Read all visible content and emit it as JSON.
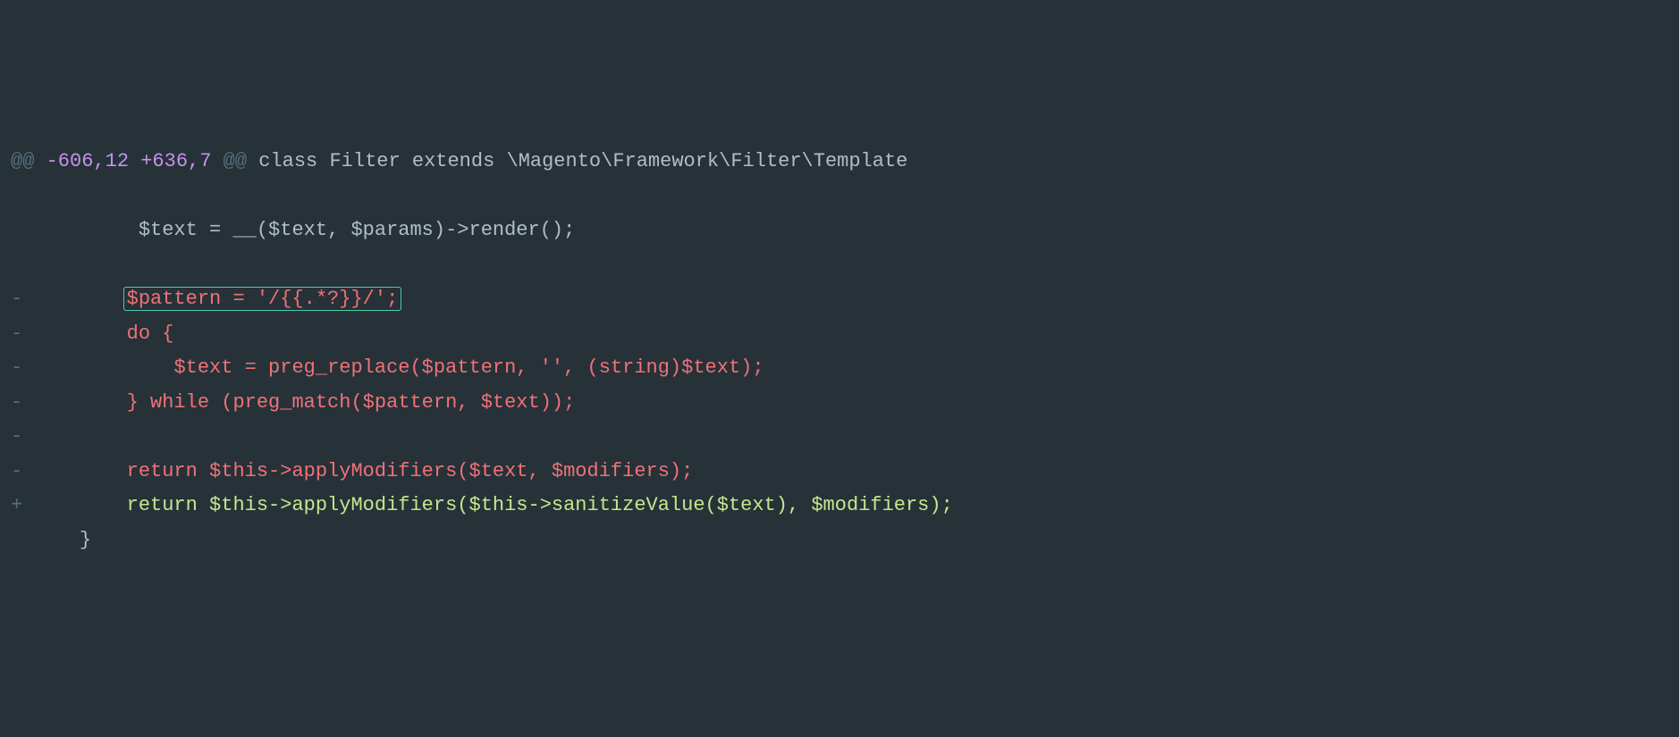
{
  "diff": {
    "hunk": {
      "marker_open": "@@",
      "range": " -606,12 +636,7 ",
      "marker_close": "@@",
      "context": " class Filter extends \\Magento\\Framework\\Filter\\Template"
    },
    "lines": [
      {
        "type": "context",
        "marker": " ",
        "indent": "         ",
        "code": "$text = __($text, $params)->render();"
      },
      {
        "type": "empty",
        "marker": " ",
        "indent": "",
        "code": ""
      },
      {
        "type": "deleted",
        "marker": "-",
        "indent": "        ",
        "code": "$pattern = '/{{.*?}}/';",
        "highlighted": true
      },
      {
        "type": "deleted",
        "marker": "-",
        "indent": "        ",
        "code": "do {"
      },
      {
        "type": "deleted",
        "marker": "-",
        "indent": "            ",
        "code": "$text = preg_replace($pattern, '', (string)$text);"
      },
      {
        "type": "deleted",
        "marker": "-",
        "indent": "        ",
        "code": "} while (preg_match($pattern, $text));"
      },
      {
        "type": "deleted",
        "marker": "-",
        "indent": "",
        "code": ""
      },
      {
        "type": "deleted",
        "marker": "-",
        "indent": "        ",
        "code": "return $this->applyModifiers($text, $modifiers);"
      },
      {
        "type": "added",
        "marker": "+",
        "indent": "        ",
        "code": "return $this->applyModifiers($this->sanitizeValue($text), $modifiers);"
      },
      {
        "type": "context",
        "marker": " ",
        "indent": "    ",
        "code": "}"
      }
    ]
  }
}
